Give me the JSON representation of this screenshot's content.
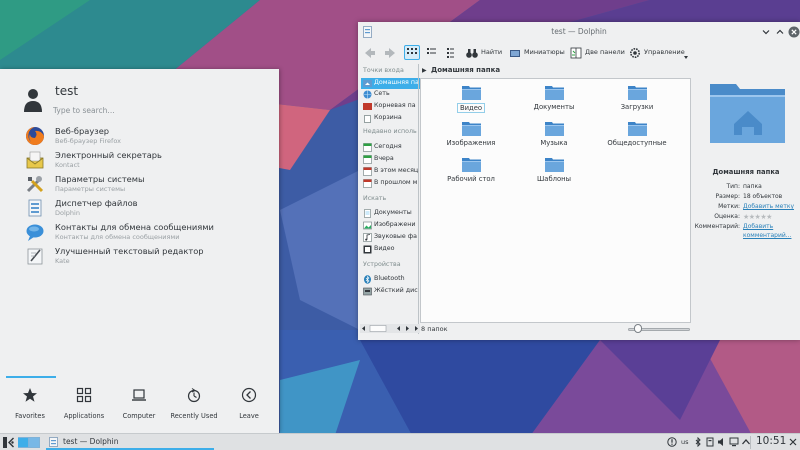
{
  "launcher": {
    "username": "test",
    "search_placeholder": "Type to search...",
    "apps": [
      {
        "name": "Веб-браузер",
        "desc": "Веб-браузер Firefox",
        "icon": "firefox-icon"
      },
      {
        "name": "Электронный секретарь",
        "desc": "Kontact",
        "icon": "kontact-icon"
      },
      {
        "name": "Параметры системы",
        "desc": "Параметры системы",
        "icon": "system-settings-icon"
      },
      {
        "name": "Диспетчер файлов",
        "desc": "Dolphin",
        "icon": "dolphin-icon"
      },
      {
        "name": "Контакты для обмена сообщениями",
        "desc": "Контакты для обмена сообщениями",
        "icon": "chat-bubble-icon"
      },
      {
        "name": "Улучшенный текстовый редактор",
        "desc": "Kate",
        "icon": "text-editor-icon"
      }
    ],
    "tabs": [
      {
        "label": "Favorites",
        "icon": "star-icon"
      },
      {
        "label": "Applications",
        "icon": "grid-icon"
      },
      {
        "label": "Computer",
        "icon": "laptop-icon"
      },
      {
        "label": "Recently Used",
        "icon": "history-icon"
      },
      {
        "label": "Leave",
        "icon": "leave-arrow-icon"
      }
    ],
    "active_tab": "Favorites"
  },
  "dolphin": {
    "title": "test — Dolphin",
    "toolbar": {
      "find": "Найти",
      "preview": "Миниатюры",
      "split": "Две панели",
      "control": "Управление"
    },
    "places": {
      "groups": {
        "places": "Точки входа",
        "recent": "Недавно исполь",
        "search": "Искать",
        "devices": "Устройства"
      },
      "items": [
        {
          "label": "Домашняя па",
          "icon": "home-folder-icon",
          "selected": true
        },
        {
          "label": "Сеть",
          "icon": "network-icon"
        },
        {
          "label": "Корневая па",
          "icon": "root-folder-icon"
        },
        {
          "label": "Корзина",
          "icon": "trash-icon"
        },
        {
          "label": "Сегодня",
          "icon": "calendar-icon"
        },
        {
          "label": "Вчера",
          "icon": "calendar-icon"
        },
        {
          "label": "В этом месяц",
          "icon": "calendar-icon"
        },
        {
          "label": "В прошлом м",
          "icon": "calendar-icon"
        },
        {
          "label": "Документы",
          "icon": "document-icon"
        },
        {
          "label": "Изображени",
          "icon": "image-icon"
        },
        {
          "label": "Звуковые фа",
          "icon": "audio-icon"
        },
        {
          "label": "Видео",
          "icon": "video-icon"
        },
        {
          "label": "Bluetooth",
          "icon": "bluetooth-icon"
        },
        {
          "label": "Жёсткий дис",
          "icon": "harddisk-icon"
        }
      ]
    },
    "breadcrumb": "Домашняя папка",
    "files": [
      "Видео",
      "Документы",
      "Загрузки",
      "Изображения",
      "Музыка",
      "Общедоступные",
      "Рабочий стол",
      "Шаблоны"
    ],
    "focused_file": "Видео",
    "status": "8 папок",
    "info": {
      "title": "Домашняя папка",
      "rows": [
        {
          "key": "Тип:",
          "value": "папка"
        },
        {
          "key": "Размер:",
          "value": "18 объектов"
        },
        {
          "key": "Метки:",
          "value": "Добавить метку",
          "link": true
        },
        {
          "key": "Оценка:",
          "value": "",
          "rating": 0
        },
        {
          "key": "Комментарий:",
          "value": "Добавить",
          "link": true
        },
        {
          "key": "",
          "value": "комментарий...",
          "link": true
        }
      ]
    }
  },
  "taskbar": {
    "task_label": "test — Dolphin",
    "keyboard_layout": "us",
    "clock": "10:51"
  }
}
